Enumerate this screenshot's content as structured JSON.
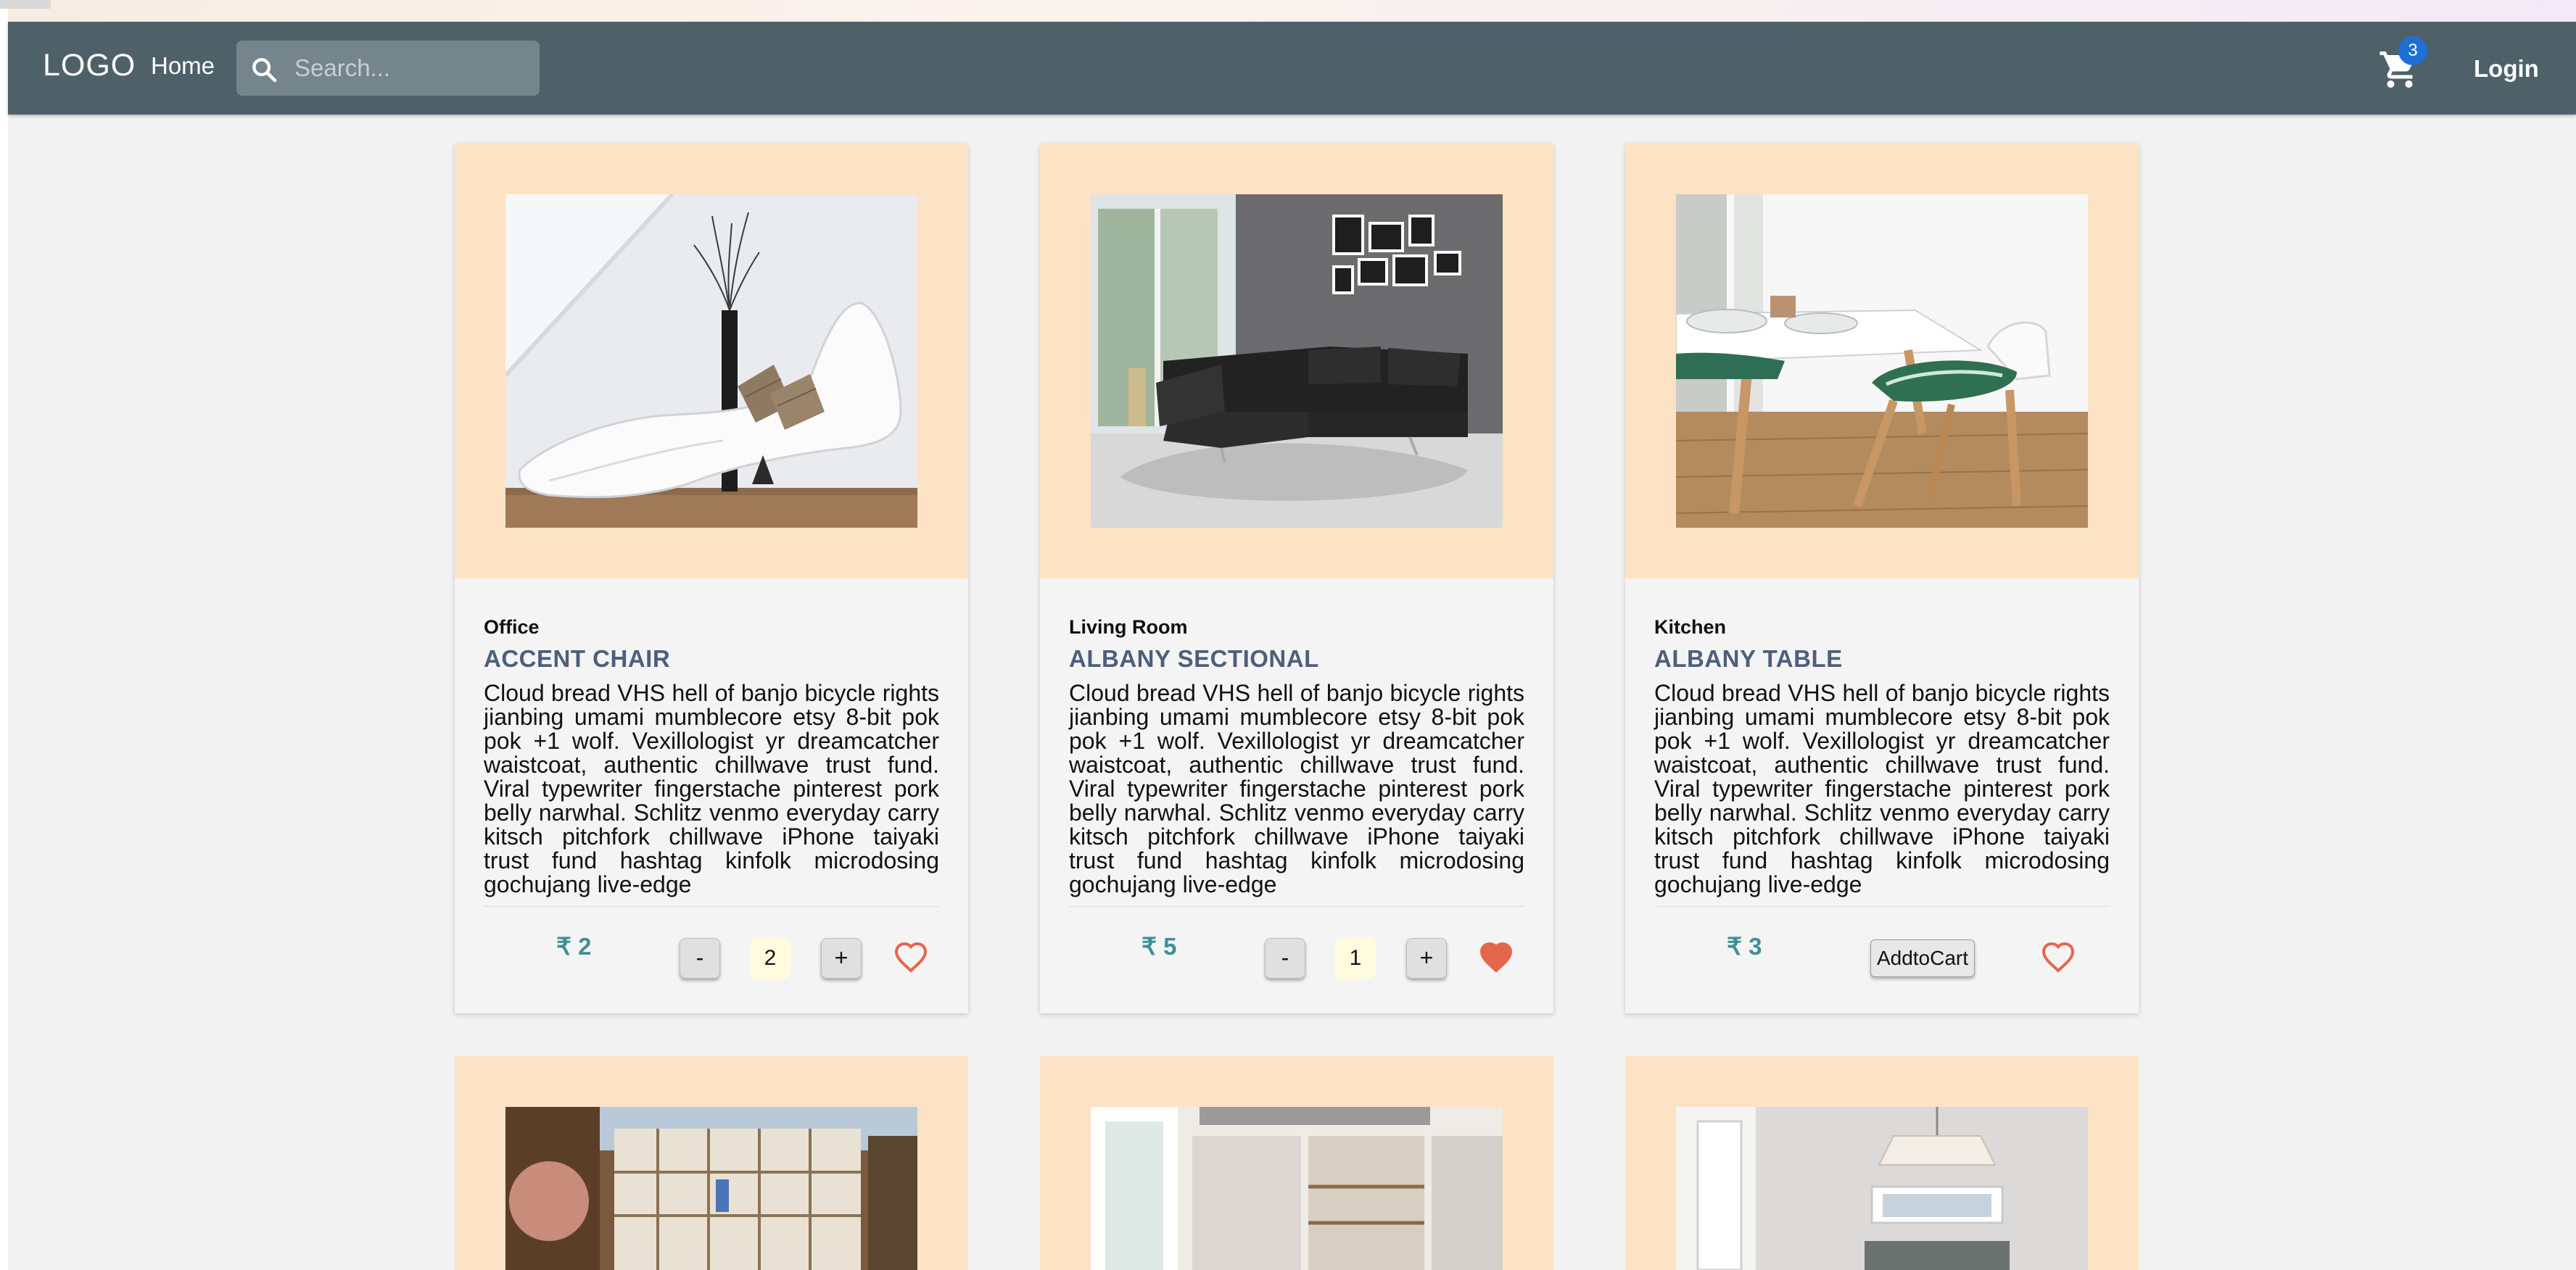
{
  "navbar": {
    "logo": "LOGO",
    "home": "Home",
    "search_placeholder": "Search...",
    "cart_count": "3",
    "login": "Login"
  },
  "products": [
    {
      "category": "Office",
      "title": "ACCENT CHAIR",
      "description": "Cloud bread VHS hell of banjo bicycle rights jianbing umami mumblecore etsy 8-bit pok pok +1 wolf. Vexillologist yr dreamcatcher waistcoat, authentic chillwave trust fund. Viral typewriter fingerstache pinterest pork belly narwhal. Schlitz venmo everyday carry kitsch pitchfork chillwave iPhone taiyaki trust fund hashtag kinfolk microdosing gochujang live-edge",
      "price": "₹ 2",
      "qty": "2",
      "minus": "-",
      "plus": "+",
      "favorited": false
    },
    {
      "category": "Living Room",
      "title": "ALBANY SECTIONAL",
      "description": "Cloud bread VHS hell of banjo bicycle rights jianbing umami mumblecore etsy 8-bit pok pok +1 wolf. Vexillologist yr dreamcatcher waistcoat, authentic chillwave trust fund. Viral typewriter fingerstache pinterest pork belly narwhal. Schlitz venmo everyday carry kitsch pitchfork chillwave iPhone taiyaki trust fund hashtag kinfolk microdosing gochujang live-edge",
      "price": "₹ 5",
      "qty": "1",
      "minus": "-",
      "plus": "+",
      "favorited": true
    },
    {
      "category": "Kitchen",
      "title": "ALBANY TABLE",
      "description": "Cloud bread VHS hell of banjo bicycle rights jianbing umami mumblecore etsy 8-bit pok pok +1 wolf. Vexillologist yr dreamcatcher waistcoat, authentic chillwave trust fund. Viral typewriter fingerstache pinterest pork belly narwhal. Schlitz venmo everyday carry kitsch pitchfork chillwave iPhone taiyaki trust fund hashtag kinfolk microdosing gochujang live-edge",
      "price": "₹ 3",
      "add_to_cart": "AddtoCart",
      "favorited": false
    }
  ],
  "colors": {
    "navbar": "#4e6169",
    "card_image_bg": "#fde3c5",
    "title": "#4e5e7c",
    "price": "#3f8f95",
    "heart": "#e4664d",
    "badge": "#1f6fd6"
  },
  "icons": {
    "search": "search-icon",
    "cart": "cart-icon",
    "heart": "heart-icon"
  }
}
